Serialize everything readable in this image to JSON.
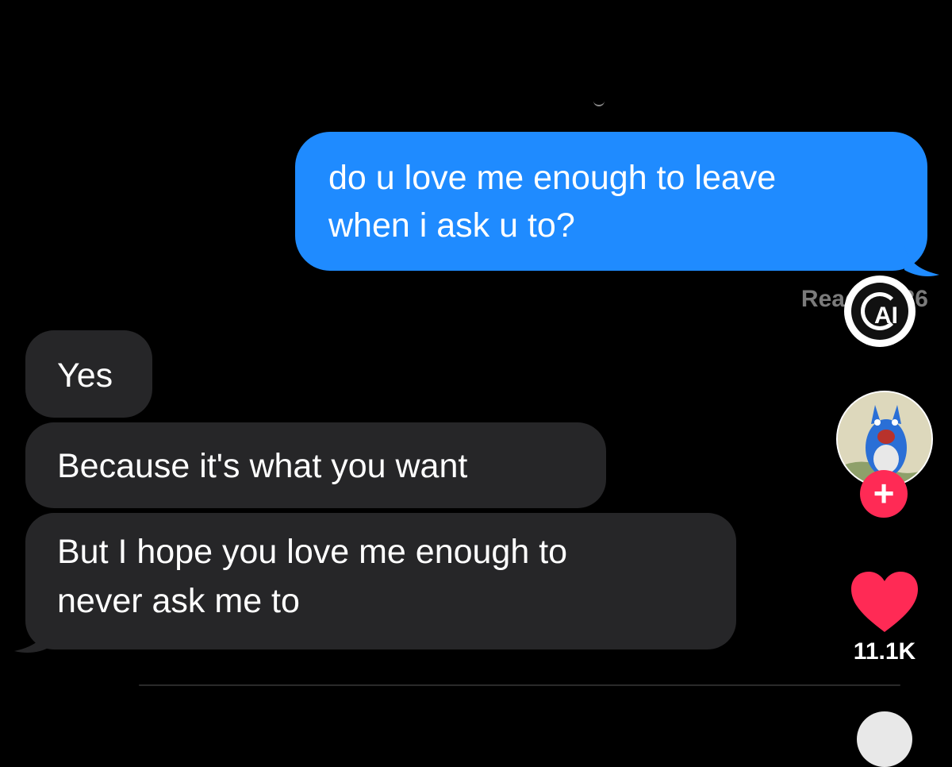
{
  "messages": {
    "sent": [
      {
        "text": "do u love me enough to leave\nwhen i ask u to?"
      }
    ],
    "read_receipt": "Read 0?:36",
    "received": [
      {
        "text": "Yes"
      },
      {
        "text": "Because it's what you want"
      },
      {
        "text": "But I hope you love me enough to\nnever ask me to"
      }
    ]
  },
  "overlay": {
    "ai_badge": "AI",
    "like_count": "11.1K",
    "follow_symbol": "+"
  },
  "colors": {
    "background": "#000000",
    "sent_bubble": "#1f8bff",
    "received_bubble": "#262628",
    "like_red": "#ff2a55",
    "read_gray": "#7b7b7b"
  },
  "icons": [
    "ai-label-icon",
    "avatar-totoro",
    "plus-icon",
    "heart-icon"
  ]
}
